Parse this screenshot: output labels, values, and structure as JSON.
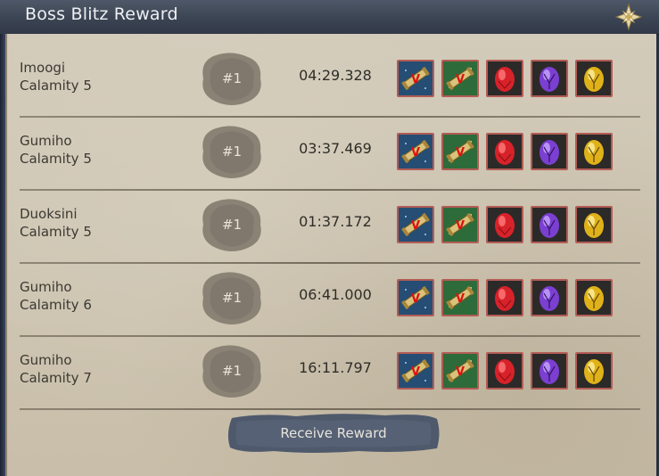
{
  "window": {
    "title": "Boss Blitz Reward",
    "close_icon": "compass-star-close-icon"
  },
  "rows": [
    {
      "boss": "Imoogi",
      "difficulty": "Calamity 5",
      "rank": "#1",
      "time": "04:29.328"
    },
    {
      "boss": "Gumiho",
      "difficulty": "Calamity 5",
      "rank": "#1",
      "time": "03:37.469"
    },
    {
      "boss": "Duoksini",
      "difficulty": "Calamity 5",
      "rank": "#1",
      "time": "01:37.172"
    },
    {
      "boss": "Gumiho",
      "difficulty": "Calamity 6",
      "rank": "#1",
      "time": "06:41.000"
    },
    {
      "boss": "Gumiho",
      "difficulty": "Calamity 7",
      "rank": "#1",
      "time": "16:11.797"
    }
  ],
  "reward_icons": [
    "blue-scroll-icon",
    "green-scroll-icon",
    "red-gem-icon",
    "purple-gem-icon",
    "gold-gem-icon"
  ],
  "colors": {
    "slot_border": "#b35c55",
    "red_gem": "#d8222a",
    "purple_gem": "#7b3fd1",
    "gold_gem": "#e0b21a",
    "title_text": "#eef0f3"
  },
  "footer": {
    "receive_label": "Receive Reward"
  }
}
